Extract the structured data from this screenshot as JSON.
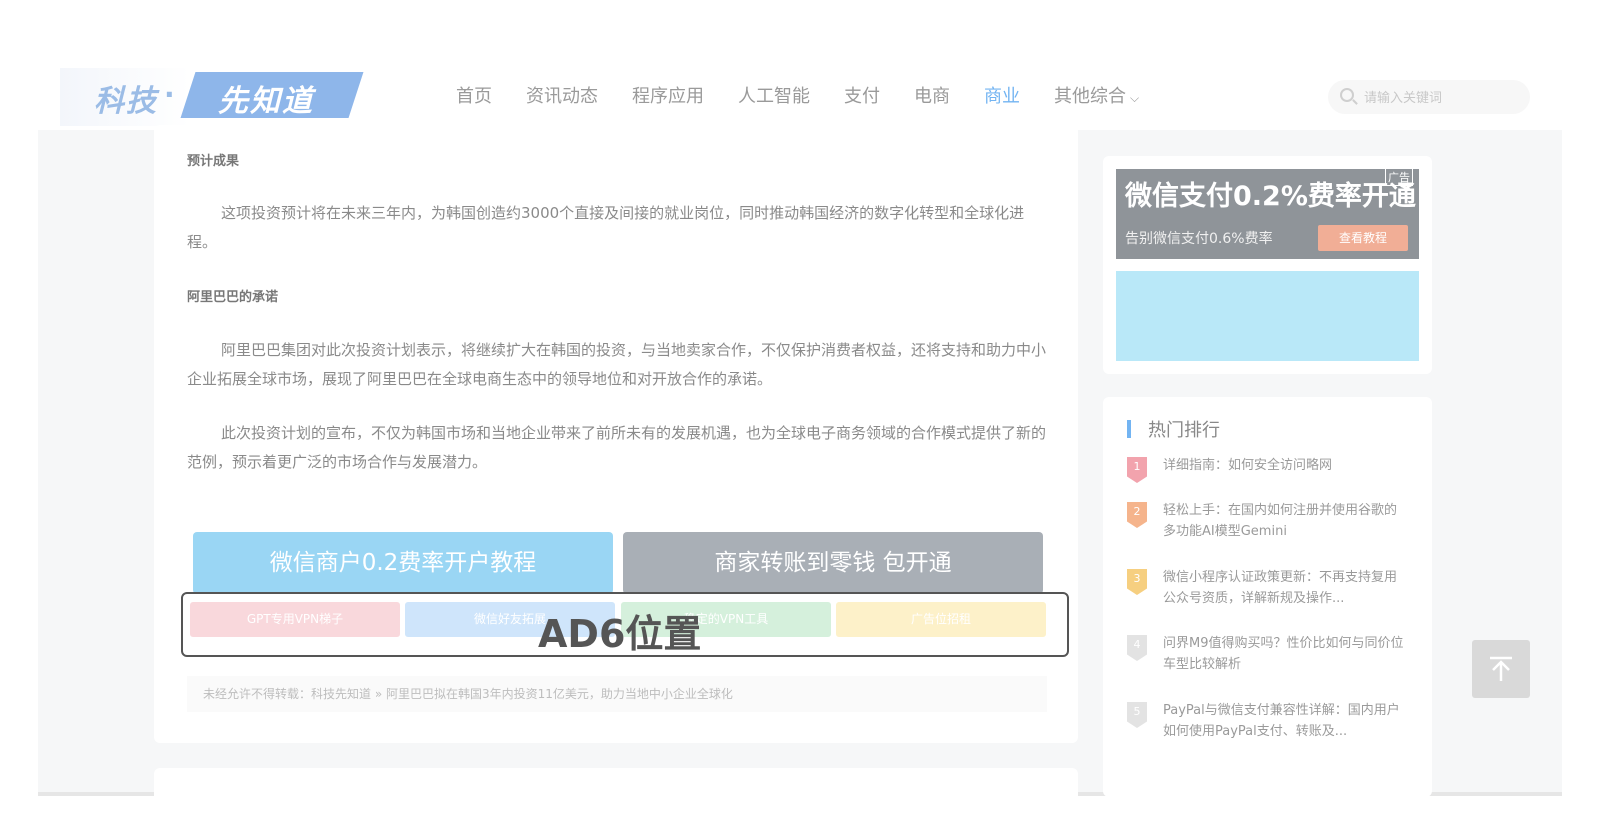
{
  "header": {
    "logo_part1": "科技",
    "logo_dot": "·",
    "logo_part2": "先知道",
    "nav": [
      {
        "label": "首页"
      },
      {
        "label": "资讯动态"
      },
      {
        "label": "程序应用"
      },
      {
        "label": "人工智能"
      },
      {
        "label": "支付"
      },
      {
        "label": "电商"
      },
      {
        "label": "商业",
        "active": true
      },
      {
        "label": "其他综合"
      }
    ],
    "search_placeholder": "请输入关键词"
  },
  "article": {
    "h1": "预计成果",
    "p1": "这项投资预计将在未来三年内，为韩国创造约3000个直接及间接的就业岗位，同时推动韩国经济的数字化转型和全球化进程。",
    "h2": "阿里巴巴的承诺",
    "p2": "阿里巴巴集团对此次投资计划表示，将继续扩大在韩国的投资，与当地卖家合作，不仅保护消费者权益，还将支持和助力中小企业拓展全球市场，展现了阿里巴巴在全球电商生态中的领导地位和对开放合作的承诺。",
    "p3": "此次投资计划的宣布，不仅为韩国市场和当地企业带来了前所未有的发展机遇，也为全球电子商务领域的合作模式提供了新的范例，预示着更广泛的市场合作与发展潜力。",
    "btn_wechat": "微信商户0.2费率开户教程",
    "btn_merchant": "商家转账到零钱 包开通",
    "mini_ads": [
      "GPT专用VPN梯子",
      "微信好友拓展",
      "稳定的VPN工具",
      "广告位招租"
    ],
    "ad_slot_label": "AD6位置",
    "copyright": "未经允许不得转载：科技先知道 » 阿里巴巴拟在韩国3年内投资11亿美元，助力当地中小企业全球化"
  },
  "sidebar": {
    "ad": {
      "title": "微信支付0.2%费率开通",
      "tag": "广告",
      "subtitle": "告别微信支付0.6%费率",
      "button": "查看教程"
    },
    "hot": {
      "title": "热门排行",
      "items": [
        {
          "rank": "1",
          "color": "#f2a3ad",
          "text": "详细指南：如何安全访问略网"
        },
        {
          "rank": "2",
          "color": "#f5b48c",
          "text": "轻松上手：在国内如何注册并使用谷歌的多功能AI模型Gemini"
        },
        {
          "rank": "3",
          "color": "#f6cf80",
          "text": "微信小程序认证政策更新：不再支持复用公众号资质，详解新规及操作..."
        },
        {
          "rank": "4",
          "color": "#e3e3e3",
          "text": "问界M9值得购买吗？性价比如何与同价位车型比较解析"
        },
        {
          "rank": "5",
          "color": "#e3e3e3",
          "text": "PayPal与微信支付兼容性详解：国内用户如何使用PayPal支付、转账及..."
        }
      ]
    }
  }
}
